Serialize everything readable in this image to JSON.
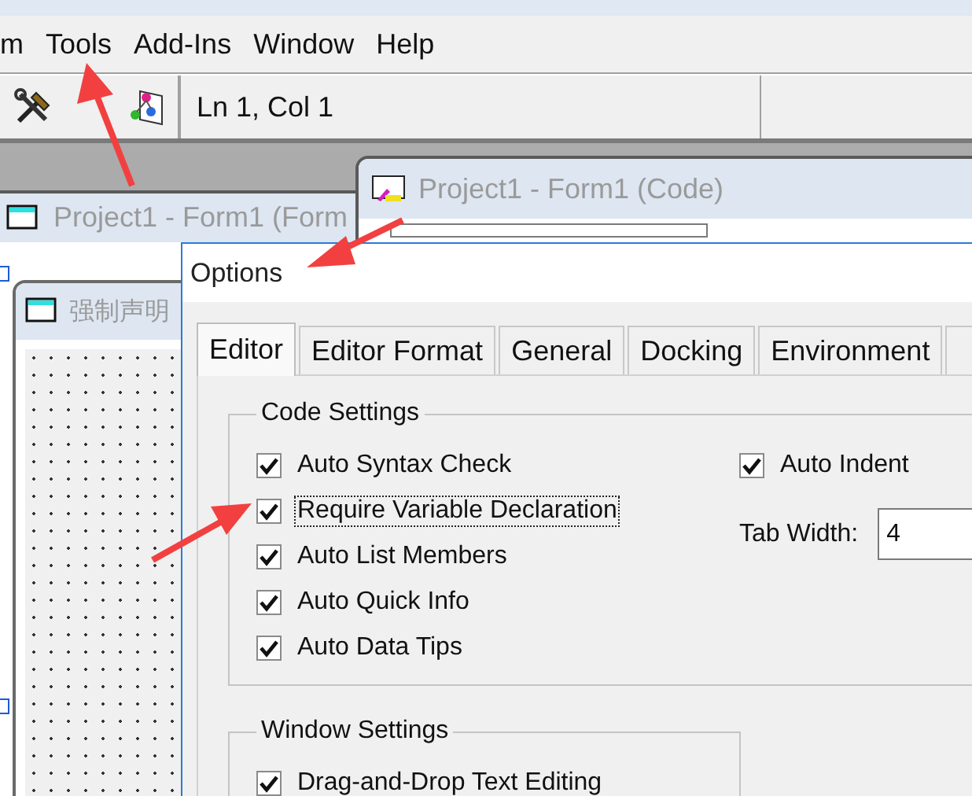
{
  "menu": [
    {
      "label": "m"
    },
    {
      "label": "Tools"
    },
    {
      "label": "Add-Ins"
    },
    {
      "label": "Window"
    },
    {
      "label": "Help"
    }
  ],
  "toolbar": {
    "position": "Ln 1, Col 1"
  },
  "windows": [
    {
      "kind": "code",
      "title": "Project1 - Form1 (Code)",
      "active": false
    },
    {
      "kind": "form",
      "title": "Project1 - Form1 (Form",
      "active": false
    },
    {
      "kind": "designer",
      "title": "强制声明",
      "active": false
    }
  ],
  "dialog": {
    "title": "Options",
    "tabs": [
      {
        "label": "Editor",
        "selected": true
      },
      {
        "label": "Editor Format",
        "selected": false
      },
      {
        "label": "General",
        "selected": false
      },
      {
        "label": "Docking",
        "selected": false
      },
      {
        "label": "Environment",
        "selected": false
      }
    ],
    "code_settings": {
      "title": "Code Settings",
      "options": [
        {
          "label": "Auto Syntax Check",
          "checked": true,
          "focused": false
        },
        {
          "label": "Require Variable Declaration",
          "checked": true,
          "focused": true
        },
        {
          "label": "Auto List Members",
          "checked": true,
          "focused": false
        },
        {
          "label": "Auto Quick Info",
          "checked": true,
          "focused": false
        },
        {
          "label": "Auto Data Tips",
          "checked": true,
          "focused": false
        }
      ],
      "right": [
        {
          "kind": "checkbox",
          "label": "Auto Indent",
          "checked": true
        },
        {
          "kind": "field",
          "label": "Tab Width:",
          "value": "4"
        }
      ]
    },
    "window_settings": {
      "title": "Window Settings",
      "options": [
        {
          "label": "Drag-and-Drop Text Editing",
          "checked": true,
          "focused": false
        }
      ]
    }
  }
}
